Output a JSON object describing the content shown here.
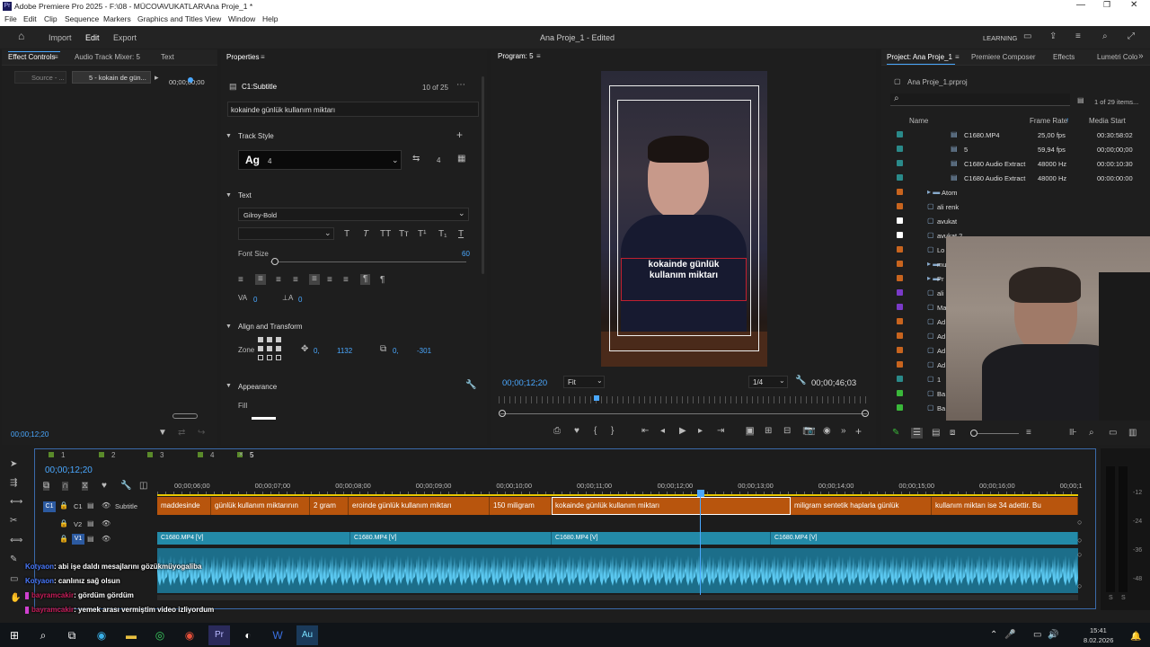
{
  "window": {
    "title": "Adobe Premiere Pro 2025 - F:\\08 - MÜCO\\AVUKATLAR\\Ana Proje_1 *"
  },
  "menu": [
    "File",
    "Edit",
    "Clip",
    "Sequence",
    "Markers",
    "Graphics and Titles",
    "View",
    "Window",
    "Help"
  ],
  "appbar": {
    "tabs": [
      "Import",
      "Edit",
      "Export"
    ],
    "sequence_title": "Ana Proje_1 - Edited",
    "learning": "LEARNING"
  },
  "left_tabs": [
    "Effect Controls",
    "Audio Track Mixer: 5",
    "Text"
  ],
  "source_tabs": [
    "Source - ...",
    "5 - kokain de gün..."
  ],
  "effect_time": "00;00;00;00",
  "effect_timecode": "00;00;12;20",
  "properties": {
    "title": "Properties",
    "clip": "C1:Subtitle",
    "counter": "10 of 25",
    "caption_text": "kokainde günlük  kullanım miktarı",
    "track_style": "Track Style",
    "style_name": "4",
    "style_num": "4",
    "text_section": "Text",
    "font": "Gilroy-Bold",
    "font_size_label": "Font Size",
    "font_size": "60",
    "tracking": "0",
    "kerning": "0",
    "align_section": "Align and Transform",
    "zone": "Zone",
    "pos_x": "0,",
    "pos_y": "1132",
    "off_x": "0,",
    "off_y": "-301",
    "appearance": "Appearance",
    "fill": "Fill"
  },
  "program": {
    "title": "Program: 5",
    "overlay_line1": "kokainde günlük",
    "overlay_line2": "kullanım miktarı",
    "timecode": "00;00;12;20",
    "fit": "Fit",
    "quality": "1/4",
    "duration": "00;00;46;03"
  },
  "project": {
    "tabs": [
      "Project: Ana Proje_1",
      "Premiere Composer",
      "Effects",
      "Lumetri Colo"
    ],
    "file": "Ana Proje_1.prproj",
    "items_count": "1 of 29 items...",
    "col_name": "Name",
    "col_rate": "Frame Rate",
    "col_start": "Media Start",
    "rows": [
      {
        "name": "C1680.MP4",
        "rate": "25,00 fps",
        "start": "00:30:58:02",
        "color": "#2a8a8a"
      },
      {
        "name": "5",
        "rate": "59,94 fps",
        "start": "00;00;00;00",
        "color": "#2a8a8a"
      },
      {
        "name": "C1680 Audio Extract",
        "rate": "48000 Hz",
        "start": "00:00:10:30",
        "color": "#2a8a8a"
      },
      {
        "name": "C1680 Audio Extract",
        "rate": "48000 Hz",
        "start": "00:00:00:00",
        "color": "#2a8a8a"
      },
      {
        "name": "Atom",
        "rate": "",
        "start": "",
        "color": "#c8641e"
      },
      {
        "name": "ali renk",
        "rate": "",
        "start": "",
        "color": "#c8641e"
      },
      {
        "name": "avukat",
        "rate": "",
        "start": "",
        "color": "#ffffff"
      },
      {
        "name": "avukat 2",
        "rate": "",
        "start": "",
        "color": "#ffffff"
      },
      {
        "name": "Lo",
        "rate": "",
        "start": "",
        "color": "#c8641e"
      },
      {
        "name": "mu",
        "rate": "",
        "start": "",
        "color": "#c8641e"
      },
      {
        "name": "Pr",
        "rate": "",
        "start": "",
        "color": "#c8641e"
      },
      {
        "name": "ali",
        "rate": "",
        "start": "",
        "color": "#7a3ac8"
      },
      {
        "name": "Ma",
        "rate": "",
        "start": "",
        "color": "#7a3ac8"
      },
      {
        "name": "Ad",
        "rate": "",
        "start": "",
        "color": "#c8641e"
      },
      {
        "name": "Ad",
        "rate": "",
        "start": "",
        "color": "#c8641e"
      },
      {
        "name": "Ad",
        "rate": "",
        "start": "",
        "color": "#c8641e"
      },
      {
        "name": "Ad",
        "rate": "",
        "start": "",
        "color": "#c8641e"
      },
      {
        "name": "1",
        "rate": "",
        "start": "",
        "color": "#2a8a8a"
      },
      {
        "name": "Ba",
        "rate": "",
        "start": "",
        "color": "#3ab83a"
      },
      {
        "name": "Ba",
        "rate": "",
        "start": "",
        "color": "#3ab83a"
      }
    ]
  },
  "timeline": {
    "seq_tabs": [
      "1",
      "2",
      "3",
      "4",
      "5"
    ],
    "timecode": "00;00;12;20",
    "ruler": [
      "00;00;06;00",
      "00;00;07;00",
      "00;00;08;00",
      "00;00;09;00",
      "00;00;10;00",
      "00;00;11;00",
      "00;00;12;00",
      "00;00;13;00",
      "00;00;14;00",
      "00;00;15;00",
      "00;00;16;00",
      "00;00;1"
    ],
    "tracks": {
      "c1": "C1",
      "subtitle": "Subtitle",
      "v2": "V2",
      "v1": "V1"
    },
    "captions": [
      "maddesinde",
      "günlük kullanım miktarının",
      "2 gram",
      "eroinde günlük kullanım miktarı",
      "150 miligram",
      "kokainde günlük  kullanım miktarı",
      "miligram sentetik haplarla günlük",
      "kullanım miktarı ise 34 adettir. Bu"
    ],
    "vclips": [
      "C1680.MP4 [V]",
      "C1680.MP4 [V]",
      "C1680.MP4 [V]",
      "C1680.MP4 [V]"
    ],
    "meter": [
      "-12",
      "-24",
      "-36",
      "-48",
      "S",
      "S"
    ]
  },
  "chat": [
    {
      "user": "Kotyaon",
      "msg": ": abi işe daldı mesajlarını gözükmüyogaliba",
      "color": "#4a7aff"
    },
    {
      "user": "Kotyaon",
      "msg": ": canlınız sağ olsun",
      "color": "#4a7aff"
    },
    {
      "user": "bayramcakir",
      "msg": ": gördüm gördüm",
      "color": "#c81e5a"
    },
    {
      "user": "bayramcakir",
      "msg": ": yemek arası vermiştim video izliyordum",
      "color": "#c81e5a"
    }
  ],
  "taskbar": {
    "time": "15:41",
    "date": "8.02.2026"
  }
}
